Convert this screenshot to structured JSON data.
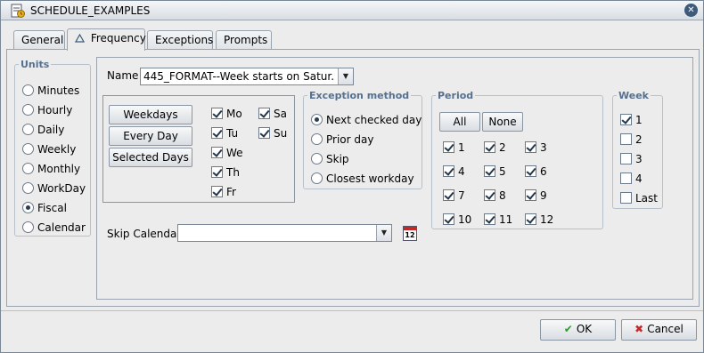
{
  "window": {
    "title": "SCHEDULE_EXAMPLES"
  },
  "tabs": [
    {
      "label": "General"
    },
    {
      "label": "Frequency"
    },
    {
      "label": "Exceptions"
    },
    {
      "label": "Prompts"
    }
  ],
  "units": {
    "legend": "Units",
    "options": [
      "Minutes",
      "Hourly",
      "Daily",
      "Weekly",
      "Monthly",
      "WorkDay",
      "Fiscal",
      "Calendar"
    ],
    "selected": "Fiscal"
  },
  "name": {
    "label": "Name",
    "value": "445_FORMAT--Week starts on Satur..."
  },
  "day_buttons": [
    "Weekdays",
    "Every Day",
    "Selected Days"
  ],
  "days": [
    {
      "label": "Mo",
      "checked": true
    },
    {
      "label": "Tu",
      "checked": true
    },
    {
      "label": "We",
      "checked": true
    },
    {
      "label": "Th",
      "checked": true
    },
    {
      "label": "Fr",
      "checked": true
    },
    {
      "label": "Sa",
      "checked": true
    },
    {
      "label": "Su",
      "checked": true
    }
  ],
  "exception_method": {
    "legend": "Exception method",
    "options": [
      "Next checked day",
      "Prior day",
      "Skip",
      "Closest workday"
    ],
    "selected": "Next checked day"
  },
  "period": {
    "legend": "Period",
    "all_label": "All",
    "none_label": "None",
    "items": [
      "1",
      "2",
      "3",
      "4",
      "5",
      "6",
      "7",
      "8",
      "9",
      "10",
      "11",
      "12"
    ],
    "all_checked": true
  },
  "week": {
    "legend": "Week",
    "items": [
      {
        "label": "1",
        "checked": true
      },
      {
        "label": "2",
        "checked": false
      },
      {
        "label": "3",
        "checked": false
      },
      {
        "label": "4",
        "checked": false
      },
      {
        "label": "Last",
        "checked": false
      }
    ]
  },
  "skip_calendar": {
    "label": "Skip Calendar",
    "value": ""
  },
  "calendar_icon_text": "12",
  "buttons": {
    "ok": "OK",
    "cancel": "Cancel"
  },
  "colors": {
    "accent": "#55708f",
    "ok_check": "#2e9a2e",
    "cancel_x": "#c62828"
  }
}
